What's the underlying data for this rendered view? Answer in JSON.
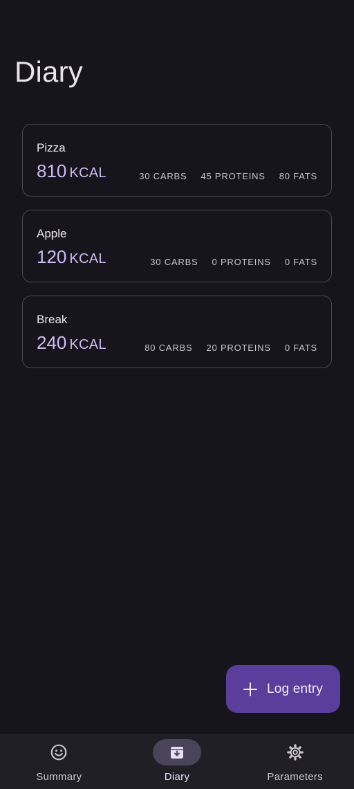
{
  "page": {
    "title": "Diary"
  },
  "entries": [
    {
      "name": "Pizza",
      "kcal": "810",
      "kcal_unit": "KCAL",
      "carbs": "30 CARBS",
      "proteins": "45 PROTEINS",
      "fats": "80 FATS"
    },
    {
      "name": "Apple",
      "kcal": "120",
      "kcal_unit": "KCAL",
      "carbs": "30 CARBS",
      "proteins": "0 PROTEINS",
      "fats": "0 FATS"
    },
    {
      "name": "Break",
      "kcal": "240",
      "kcal_unit": "KCAL",
      "carbs": "80 CARBS",
      "proteins": "20 PROTEINS",
      "fats": "0 FATS"
    }
  ],
  "fab": {
    "label": "Log entry",
    "icon": "plus-icon"
  },
  "nav": {
    "items": [
      {
        "label": "Summary",
        "icon": "smiley-icon",
        "active": false
      },
      {
        "label": "Diary",
        "icon": "archive-download-icon",
        "active": true
      },
      {
        "label": "Parameters",
        "icon": "gear-icon",
        "active": false
      }
    ]
  },
  "colors": {
    "background": "#16151b",
    "accent_text": "#cdbcf6",
    "fab": "#5b3d9b",
    "nav_background": "#211f26",
    "nav_active_indicator": "#4a4458"
  }
}
